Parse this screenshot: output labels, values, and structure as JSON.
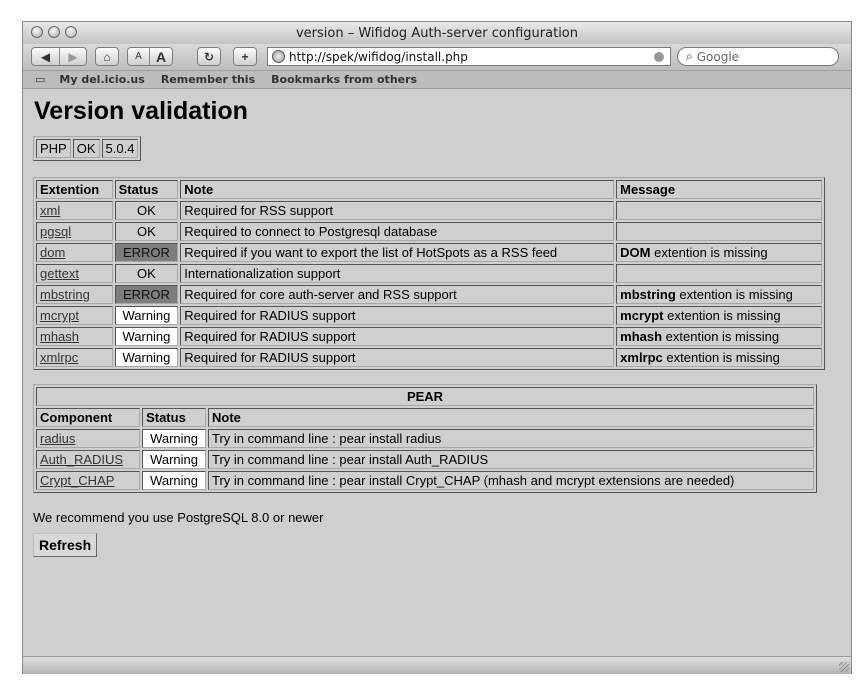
{
  "window": {
    "title": "version – Wifidog Auth-server configuration"
  },
  "toolbar": {
    "text_small": "A",
    "text_large": "A",
    "url": "http://spek/wifidog/install.php",
    "search_placeholder": "Google"
  },
  "bookmarks": [
    "My del.icio.us",
    "Remember this",
    "Bookmarks from others"
  ],
  "page": {
    "heading": "Version validation",
    "php": {
      "name": "PHP",
      "status": "OK",
      "version": "5.0.4"
    },
    "ext_headers": {
      "extension": "Extention",
      "status": "Status",
      "note": "Note",
      "message": "Message"
    },
    "extensions": [
      {
        "name": "xml",
        "status": "OK",
        "note": "Required for RSS support",
        "msg_bold": "",
        "msg_rest": ""
      },
      {
        "name": "pgsql",
        "status": "OK",
        "note": "Required to connect to Postgresql database",
        "msg_bold": "",
        "msg_rest": ""
      },
      {
        "name": "dom",
        "status": "ERROR",
        "note": "Required if you want to export the list of HotSpots as a RSS feed",
        "msg_bold": "DOM",
        "msg_rest": " extention is missing"
      },
      {
        "name": "gettext",
        "status": "OK",
        "note": "Internationalization support",
        "msg_bold": "",
        "msg_rest": ""
      },
      {
        "name": "mbstring",
        "status": "ERROR",
        "note": "Required for core auth-server and RSS support",
        "msg_bold": "mbstring",
        "msg_rest": " extention is missing"
      },
      {
        "name": "mcrypt",
        "status": "Warning",
        "note": "Required for RADIUS support",
        "msg_bold": "mcrypt",
        "msg_rest": " extention is missing"
      },
      {
        "name": "mhash",
        "status": "Warning",
        "note": "Required for RADIUS support",
        "msg_bold": "mhash",
        "msg_rest": " extention is missing"
      },
      {
        "name": "xmlrpc",
        "status": "Warning",
        "note": "Required for RADIUS support",
        "msg_bold": "xmlrpc",
        "msg_rest": " extention is missing"
      }
    ],
    "pear": {
      "title": "PEAR",
      "headers": {
        "component": "Component",
        "status": "Status",
        "note": "Note"
      },
      "rows": [
        {
          "name": "radius",
          "status": "Warning",
          "note": "Try in command line : pear install radius"
        },
        {
          "name": "Auth_RADIUS",
          "status": "Warning",
          "note": "Try in command line : pear install Auth_RADIUS"
        },
        {
          "name": "Crypt_CHAP",
          "status": "Warning",
          "note": "Try in command line : pear install Crypt_CHAP (mhash and mcrypt extensions are needed)"
        }
      ]
    },
    "recommend": "We recommend you use PostgreSQL 8.0 or newer",
    "refresh_label": "Refresh"
  },
  "colors": {
    "error_bg": "#7d7d7d",
    "warning_bg": "#ffffff",
    "page_bg": "#cfcfcf"
  }
}
